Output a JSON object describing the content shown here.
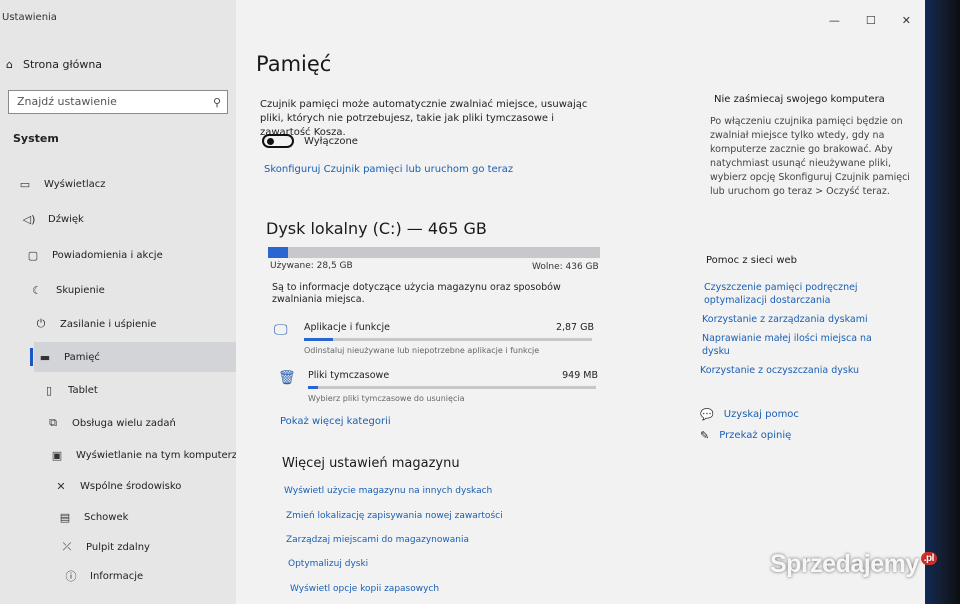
{
  "window": {
    "title": "Ustawienia"
  },
  "sidebar": {
    "home_label": "Strona główna",
    "search_placeholder": "Znajdź ustawienie",
    "section_label": "System",
    "items": [
      {
        "label": "Wyświetlacz",
        "icon": "monitor-icon"
      },
      {
        "label": "Dźwięk",
        "icon": "speaker-icon"
      },
      {
        "label": "Powiadomienia i akcje",
        "icon": "notification-icon"
      },
      {
        "label": "Skupienie",
        "icon": "moon-icon"
      },
      {
        "label": "Zasilanie i uśpienie",
        "icon": "power-icon"
      },
      {
        "label": "Pamięć",
        "icon": "storage-icon",
        "active": true
      },
      {
        "label": "Tablet",
        "icon": "tablet-icon"
      },
      {
        "label": "Obsługa wielu zadań",
        "icon": "multitask-icon"
      },
      {
        "label": "Wyświetlanie na tym komputerze",
        "icon": "project-icon"
      },
      {
        "label": "Wspólne środowisko",
        "icon": "shared-icon"
      },
      {
        "label": "Schowek",
        "icon": "clipboard-icon"
      },
      {
        "label": "Pulpit zdalny",
        "icon": "remote-desktop-icon"
      },
      {
        "label": "Informacje",
        "icon": "info-icon"
      }
    ]
  },
  "main": {
    "title": "Pamięć",
    "sense_description": "Czujnik pamięci może automatycznie zwalniać miejsce, usuwając pliki, których nie potrzebujesz, takie jak pliki tymczasowe i zawartość Kosza.",
    "toggle_state": "Wyłączone",
    "toggle_on": false,
    "configure_link": "Skonfiguruj Czujnik pamięci lub uruchom go teraz",
    "disk": {
      "title": "Dysk lokalny (C:) — 465 GB",
      "used_label": "Używane: 28,5 GB",
      "free_label": "Wolne: 436 GB",
      "used_fraction": 0.061,
      "info": "Są to informacje dotyczące użycia magazynu oraz sposobów zwalniania miejsca."
    },
    "categories": [
      {
        "name": "Aplikacje i funkcje",
        "size": "2,87 GB",
        "sub": "Odinstaluj nieużywane lub niepotrzebne aplikacje i funkcje",
        "fraction": 0.1,
        "icon": "apps-icon"
      },
      {
        "name": "Pliki tymczasowe",
        "size": "949 MB",
        "sub": "Wybierz pliki tymczasowe do usunięcia",
        "fraction": 0.035,
        "icon": "trash-icon"
      }
    ],
    "show_more": "Pokaż więcej kategorii",
    "more_settings_title": "Więcej ustawień magazynu",
    "more_links": [
      "Wyświetl użycie magazynu na innych dyskach",
      "Zmień lokalizację zapisywania nowej zawartości",
      "Zarządzaj miejscami do magazynowania",
      "Optymalizuj dyski",
      "Wyświetl opcje kopii zapasowych"
    ]
  },
  "right": {
    "tip_title": "Nie zaśmiecaj swojego komputera",
    "tip_text": "Po włączeniu czujnika pamięci będzie on zwalniał miejsce tylko wtedy, gdy na komputerze zacznie go brakować. Aby natychmiast usunąć nieużywane pliki, wybierz opcję Skonfiguruj Czujnik pamięci lub uruchom go teraz > Oczyść teraz.",
    "web_help_title": "Pomoc z sieci web",
    "web_links": [
      "Czyszczenie pamięci podręcznej optymalizacji dostarczania",
      "Korzystanie z zarządzania dyskami",
      "Naprawianie małej ilości miejsca na dysku",
      "Korzystanie z oczyszczania dysku"
    ],
    "get_help": "Uzyskaj pomoc",
    "feedback": "Przekaż opinię"
  },
  "watermark": {
    "text": "Sprzedajemy",
    "suffix": ".pl"
  },
  "colors": {
    "accent": "#2966d1",
    "link": "#1a5fb4"
  }
}
